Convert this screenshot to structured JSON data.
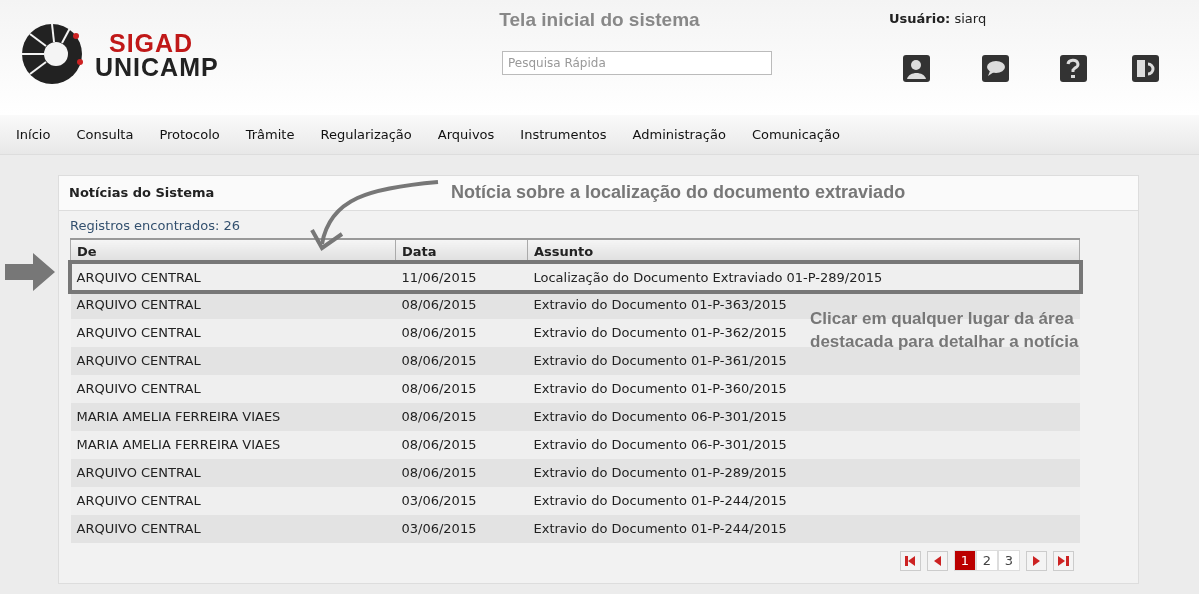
{
  "header": {
    "title": "Tela inicial do sistema",
    "logo_top": "SIGAD",
    "logo_bottom": "UNICAMP",
    "search": {
      "placeholder": "Pesquisa Rápida"
    },
    "user_label": "Usuário:",
    "user_name": "siarq"
  },
  "menu": [
    "Início",
    "Consulta",
    "Protocolo",
    "Trâmite",
    "Regularização",
    "Arquivos",
    "Instrumentos",
    "Administração",
    "Comunicação"
  ],
  "panel": {
    "title": "Notícias do Sistema",
    "count": "Registros encontrados: 26",
    "columns": [
      "De",
      "Data",
      "Assunto"
    ],
    "rows": [
      {
        "cells": [
          "ARQUIVO CENTRAL",
          "11/06/2015",
          "Localização do Documento Extraviado 01-P-289/2015"
        ],
        "highlighted": true
      },
      {
        "cells": [
          "ARQUIVO CENTRAL",
          "08/06/2015",
          "Extravio do Documento 01-P-363/2015"
        ],
        "highlighted": false
      },
      {
        "cells": [
          "ARQUIVO CENTRAL",
          "08/06/2015",
          "Extravio do Documento 01-P-362/2015"
        ],
        "highlighted": false
      },
      {
        "cells": [
          "ARQUIVO CENTRAL",
          "08/06/2015",
          "Extravio do Documento 01-P-361/2015"
        ],
        "highlighted": false
      },
      {
        "cells": [
          "ARQUIVO CENTRAL",
          "08/06/2015",
          "Extravio do Documento 01-P-360/2015"
        ],
        "highlighted": false
      },
      {
        "cells": [
          "MARIA AMELIA FERREIRA VIAES",
          "08/06/2015",
          "Extravio do Documento 06-P-301/2015"
        ],
        "highlighted": false
      },
      {
        "cells": [
          "MARIA AMELIA FERREIRA VIAES",
          "08/06/2015",
          "Extravio do Documento 06-P-301/2015"
        ],
        "highlighted": false
      },
      {
        "cells": [
          "ARQUIVO CENTRAL",
          "08/06/2015",
          "Extravio do Documento 01-P-289/2015"
        ],
        "highlighted": false
      },
      {
        "cells": [
          "ARQUIVO CENTRAL",
          "03/06/2015",
          "Extravio do Documento 01-P-244/2015"
        ],
        "highlighted": false
      },
      {
        "cells": [
          "ARQUIVO CENTRAL",
          "03/06/2015",
          "Extravio do Documento 01-P-244/2015"
        ],
        "highlighted": false
      }
    ],
    "pages": [
      {
        "label": "1",
        "selected": true
      },
      {
        "label": "2",
        "selected": false
      },
      {
        "label": "3",
        "selected": false
      }
    ]
  },
  "annotations": {
    "top_note": "Notícia sobre a localização do documento extraviado",
    "side_note": "Clicar em qualquer lugar da área destacada para detalhar a notícia"
  }
}
